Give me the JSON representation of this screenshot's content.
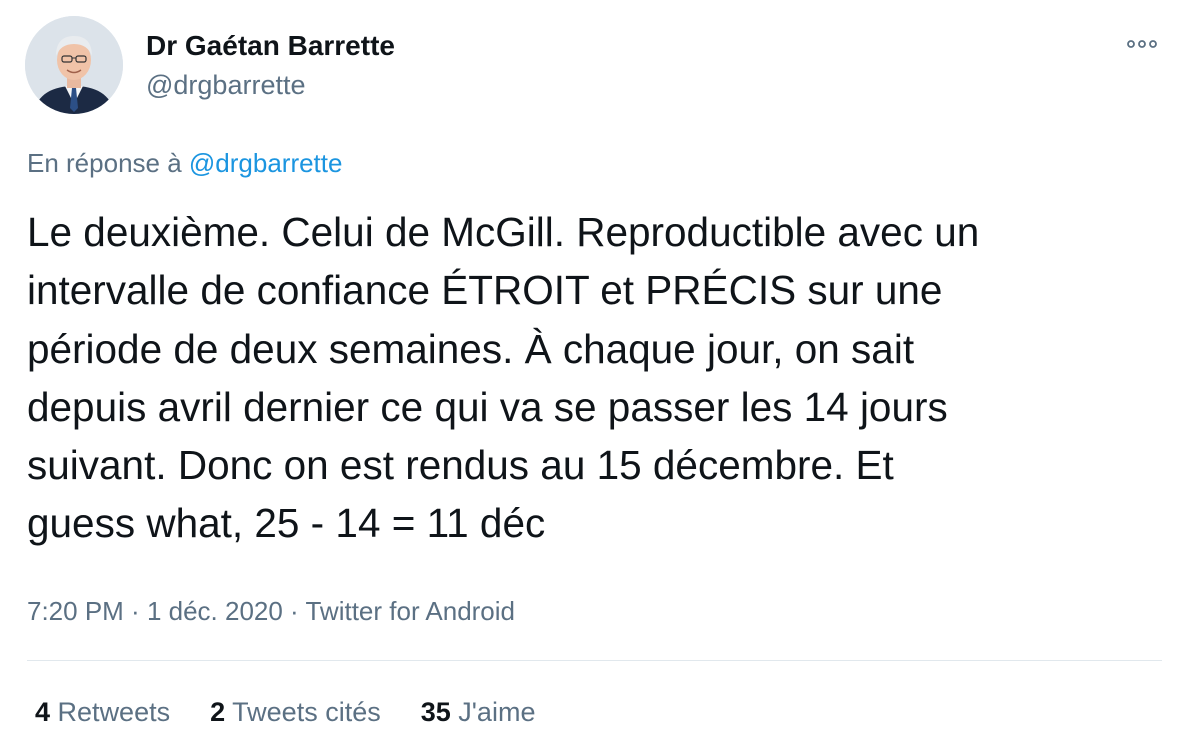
{
  "author": {
    "display_name": "Dr Gaétan Barrette",
    "handle": "@drgbarrette"
  },
  "reply": {
    "prefix": "En réponse à ",
    "mention": "@drgbarrette"
  },
  "tweet": {
    "text": "Le deuxième. Celui de McGill. Reproductible avec un\nintervalle de confiance ÉTROIT et PRÉCIS sur une\npériode de deux semaines. À chaque jour, on sait\ndepuis avril dernier ce qui va se passer les 14 jours\nsuivant. Donc on est rendus au 15 décembre. Et\nguess what, 25 - 14 = 11 déc"
  },
  "meta": {
    "time": "7:20 PM",
    "separator": " · ",
    "date": "1 déc. 2020",
    "source": "Twitter for Android"
  },
  "stats": [
    {
      "count": "4",
      "label": "Retweets"
    },
    {
      "count": "2",
      "label": "Tweets cités"
    },
    {
      "count": "35",
      "label": "J'aime"
    }
  ],
  "icons": {
    "more": "more-options-icon",
    "avatar": "profile-photo"
  },
  "colors": {
    "primary_text": "#0f1419",
    "secondary_text": "#5b7083",
    "link": "#1b95e0",
    "divider": "#e1e8ed"
  }
}
